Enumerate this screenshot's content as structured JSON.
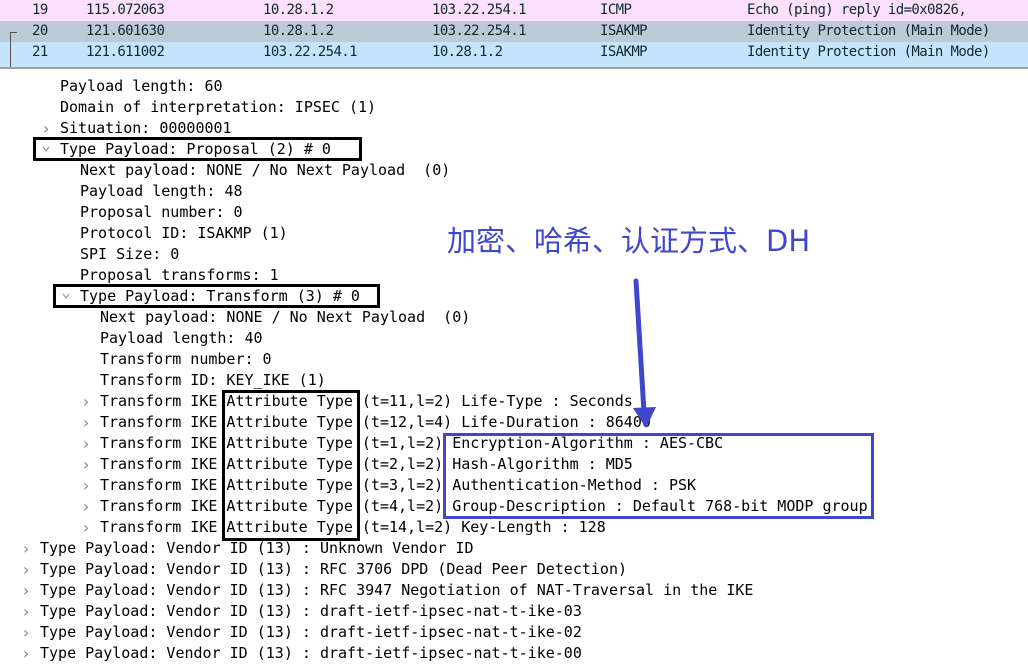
{
  "packet_list": {
    "rows": [
      {
        "no": "19",
        "time": "115.072063",
        "src": "10.28.1.2",
        "dst": "103.22.254.1",
        "proto": "ICMP",
        "info": "Echo (ping) reply    id=0x0826,",
        "bg": "#fce0fc"
      },
      {
        "no": "20",
        "time": "121.601630",
        "src": "10.28.1.2",
        "dst": "103.22.254.1",
        "proto": "ISAKMP",
        "info": "Identity Protection (Main Mode)",
        "bg": "#bccad6"
      },
      {
        "no": "21",
        "time": "121.611002",
        "src": "103.22.254.1",
        "dst": "10.28.1.2",
        "proto": "ISAKMP",
        "info": "Identity Protection (Main Mode)",
        "bg": "#c4e4fc"
      }
    ]
  },
  "detail_tree": [
    {
      "level": 3,
      "exp": "",
      "text": "Payload length: 60"
    },
    {
      "level": 3,
      "exp": "",
      "text": "Domain of interpretation: IPSEC (1)"
    },
    {
      "level": 3,
      "exp": "collapsed",
      "text": "Situation: 00000001"
    },
    {
      "level": 3,
      "exp": "expanded",
      "text": "Type Payload: Proposal (2) # 0"
    },
    {
      "level": 4,
      "exp": "",
      "text": "Next payload: NONE / No Next Payload  (0)"
    },
    {
      "level": 4,
      "exp": "",
      "text": "Payload length: 48"
    },
    {
      "level": 4,
      "exp": "",
      "text": "Proposal number: 0"
    },
    {
      "level": 4,
      "exp": "",
      "text": "Protocol ID: ISAKMP (1)"
    },
    {
      "level": 4,
      "exp": "",
      "text": "SPI Size: 0"
    },
    {
      "level": 4,
      "exp": "",
      "text": "Proposal transforms: 1"
    },
    {
      "level": 4,
      "exp": "expanded",
      "text": "Type Payload: Transform (3) # 0"
    },
    {
      "level": 5,
      "exp": "",
      "text": "Next payload: NONE / No Next Payload  (0)"
    },
    {
      "level": 5,
      "exp": "",
      "text": "Payload length: 40"
    },
    {
      "level": 5,
      "exp": "",
      "text": "Transform number: 0"
    },
    {
      "level": 5,
      "exp": "",
      "text": "Transform ID: KEY_IKE (1)"
    },
    {
      "level": 5,
      "exp": "collapsed",
      "text": "Transform IKE Attribute Type (t=11,l=2) Life-Type : Seconds"
    },
    {
      "level": 5,
      "exp": "collapsed",
      "text": "Transform IKE Attribute Type (t=12,l=4) Life-Duration : 86400"
    },
    {
      "level": 5,
      "exp": "collapsed",
      "text": "Transform IKE Attribute Type (t=1,l=2) Encryption-Algorithm : AES-CBC"
    },
    {
      "level": 5,
      "exp": "collapsed",
      "text": "Transform IKE Attribute Type (t=2,l=2) Hash-Algorithm : MD5"
    },
    {
      "level": 5,
      "exp": "collapsed",
      "text": "Transform IKE Attribute Type (t=3,l=2) Authentication-Method : PSK"
    },
    {
      "level": 5,
      "exp": "collapsed",
      "text": "Transform IKE Attribute Type (t=4,l=2) Group-Description : Default 768-bit MODP group"
    },
    {
      "level": 5,
      "exp": "collapsed",
      "text": "Transform IKE Attribute Type (t=14,l=2) Key-Length : 128"
    },
    {
      "level": 2,
      "exp": "collapsed",
      "text": "Type Payload: Vendor ID (13) : Unknown Vendor ID"
    },
    {
      "level": 2,
      "exp": "collapsed",
      "text": "Type Payload: Vendor ID (13) : RFC 3706 DPD (Dead Peer Detection)"
    },
    {
      "level": 2,
      "exp": "collapsed",
      "text": "Type Payload: Vendor ID (13) : RFC 3947 Negotiation of NAT-Traversal in the IKE"
    },
    {
      "level": 2,
      "exp": "collapsed",
      "text": "Type Payload: Vendor ID (13) : draft-ietf-ipsec-nat-t-ike-03"
    },
    {
      "level": 2,
      "exp": "collapsed",
      "text": "Type Payload: Vendor ID (13) : draft-ietf-ipsec-nat-t-ike-02"
    },
    {
      "level": 2,
      "exp": "collapsed",
      "text": "Type Payload: Vendor ID (13) : draft-ietf-ipsec-nat-t-ike-00"
    }
  ],
  "annotation": {
    "note": "加密、哈希、认证方式、DH",
    "color": "#3f48cc"
  }
}
